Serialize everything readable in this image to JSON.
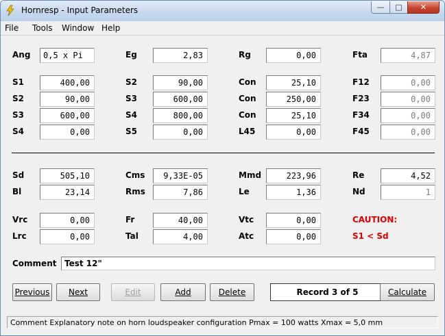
{
  "window": {
    "title": "Hornresp - Input Parameters"
  },
  "menu": [
    "File",
    "Tools",
    "Window",
    "Help"
  ],
  "params": {
    "Ang": {
      "label": "Ang",
      "value": "0,5 x Pi"
    },
    "Eg": {
      "label": "Eg",
      "value": "2,83"
    },
    "Rg": {
      "label": "Rg",
      "value": "0,00"
    },
    "Fta": {
      "label": "Fta",
      "value": "4,87"
    },
    "S1": {
      "label": "S1",
      "value": "400,00"
    },
    "S2a": {
      "label": "S2",
      "value": "90,00"
    },
    "Con1": {
      "label": "Con",
      "value": "25,10"
    },
    "F12": {
      "label": "F12",
      "value": "0,00"
    },
    "S2b": {
      "label": "S2",
      "value": "90,00"
    },
    "S3a": {
      "label": "S3",
      "value": "600,00"
    },
    "Con2": {
      "label": "Con",
      "value": "250,00"
    },
    "F23": {
      "label": "F23",
      "value": "0,00"
    },
    "S3b": {
      "label": "S3",
      "value": "600,00"
    },
    "S4a": {
      "label": "S4",
      "value": "800,00"
    },
    "Con3": {
      "label": "Con",
      "value": "25,10"
    },
    "F34": {
      "label": "F34",
      "value": "0,00"
    },
    "S4b": {
      "label": "S4",
      "value": "0,00"
    },
    "S5": {
      "label": "S5",
      "value": "0,00"
    },
    "L45": {
      "label": "L45",
      "value": "0,00"
    },
    "F45": {
      "label": "F45",
      "value": "0,00"
    },
    "Sd": {
      "label": "Sd",
      "value": "505,10"
    },
    "Cms": {
      "label": "Cms",
      "value": "9,33E-05"
    },
    "Mmd": {
      "label": "Mmd",
      "value": "223,96"
    },
    "Re": {
      "label": "Re",
      "value": "4,52"
    },
    "Bl": {
      "label": "Bl",
      "value": "23,14"
    },
    "Rms": {
      "label": "Rms",
      "value": "7,86"
    },
    "Le": {
      "label": "Le",
      "value": "1,36"
    },
    "Nd": {
      "label": "Nd",
      "value": "1"
    },
    "Vrc": {
      "label": "Vrc",
      "value": "0,00"
    },
    "Fr": {
      "label": "Fr",
      "value": "40,00"
    },
    "Vtc": {
      "label": "Vtc",
      "value": "0,00"
    },
    "Lrc": {
      "label": "Lrc",
      "value": "0,00"
    },
    "Tal": {
      "label": "Tal",
      "value": "4,00"
    },
    "Atc": {
      "label": "Atc",
      "value": "0,00"
    }
  },
  "caution": {
    "title": "CAUTION:",
    "message": "S1 < Sd"
  },
  "comment": {
    "label": "Comment",
    "value": "Test 12\""
  },
  "buttons": {
    "previous": "Previous",
    "next": "Next",
    "edit": "Edit",
    "add": "Add",
    "delete": "Delete",
    "calculate": "Calculate"
  },
  "record": "Record 3 of 5",
  "status": "Comment   Explanatory note on horn loudspeaker configuration   Pmax = 100 watts   Xmax = 5,0 mm",
  "colors": {
    "caution": "#e00000",
    "titlebar": "#c8d9ee"
  }
}
